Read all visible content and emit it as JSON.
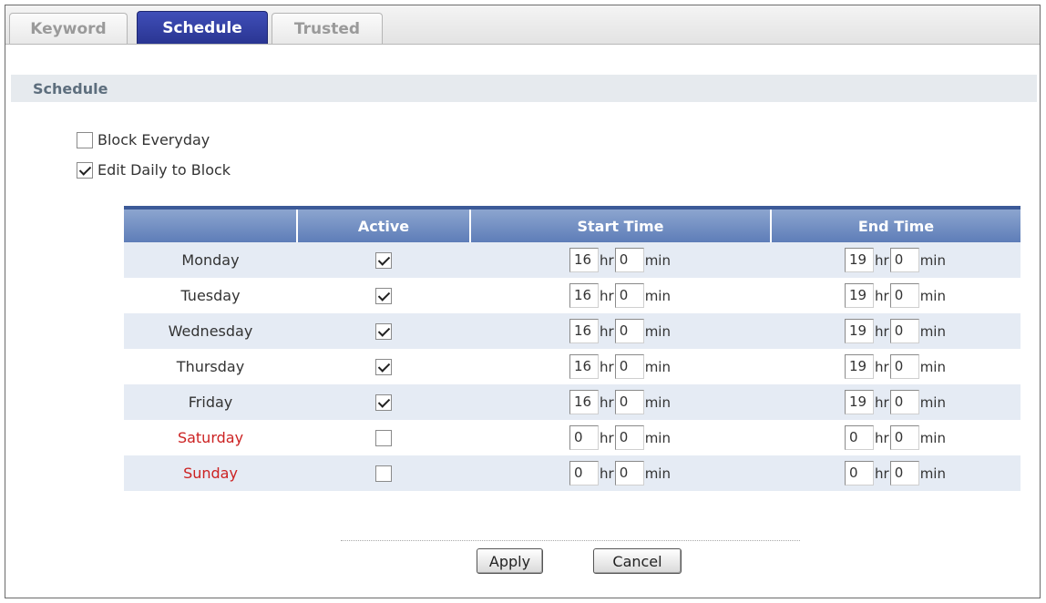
{
  "tabs": [
    {
      "label": "Keyword",
      "active": false
    },
    {
      "label": "Schedule",
      "active": true
    },
    {
      "label": "Trusted",
      "active": false
    }
  ],
  "section_title": "Schedule",
  "options": {
    "block_everyday": {
      "label": "Block Everyday",
      "checked": false
    },
    "edit_daily": {
      "label": "Edit Daily to Block",
      "checked": true
    }
  },
  "table": {
    "headers": [
      "",
      "Active",
      "Start Time",
      "End Time"
    ],
    "units": {
      "hr": "hr",
      "min": "min"
    },
    "rows": [
      {
        "day": "Monday",
        "weekend": false,
        "active": true,
        "start_hr": "16",
        "start_min": "0",
        "end_hr": "19",
        "end_min": "0"
      },
      {
        "day": "Tuesday",
        "weekend": false,
        "active": true,
        "start_hr": "16",
        "start_min": "0",
        "end_hr": "19",
        "end_min": "0"
      },
      {
        "day": "Wednesday",
        "weekend": false,
        "active": true,
        "start_hr": "16",
        "start_min": "0",
        "end_hr": "19",
        "end_min": "0"
      },
      {
        "day": "Thursday",
        "weekend": false,
        "active": true,
        "start_hr": "16",
        "start_min": "0",
        "end_hr": "19",
        "end_min": "0"
      },
      {
        "day": "Friday",
        "weekend": false,
        "active": true,
        "start_hr": "16",
        "start_min": "0",
        "end_hr": "19",
        "end_min": "0"
      },
      {
        "day": "Saturday",
        "weekend": true,
        "active": false,
        "start_hr": "0",
        "start_min": "0",
        "end_hr": "0",
        "end_min": "0"
      },
      {
        "day": "Sunday",
        "weekend": true,
        "active": false,
        "start_hr": "0",
        "start_min": "0",
        "end_hr": "0",
        "end_min": "0"
      }
    ]
  },
  "buttons": {
    "apply": "Apply",
    "cancel": "Cancel"
  },
  "colors": {
    "tab_active": "#2f3ca0",
    "header_blue": "#6f8cc2",
    "weekend_text": "#cc2222",
    "row_alt": "#e5ebf4"
  }
}
